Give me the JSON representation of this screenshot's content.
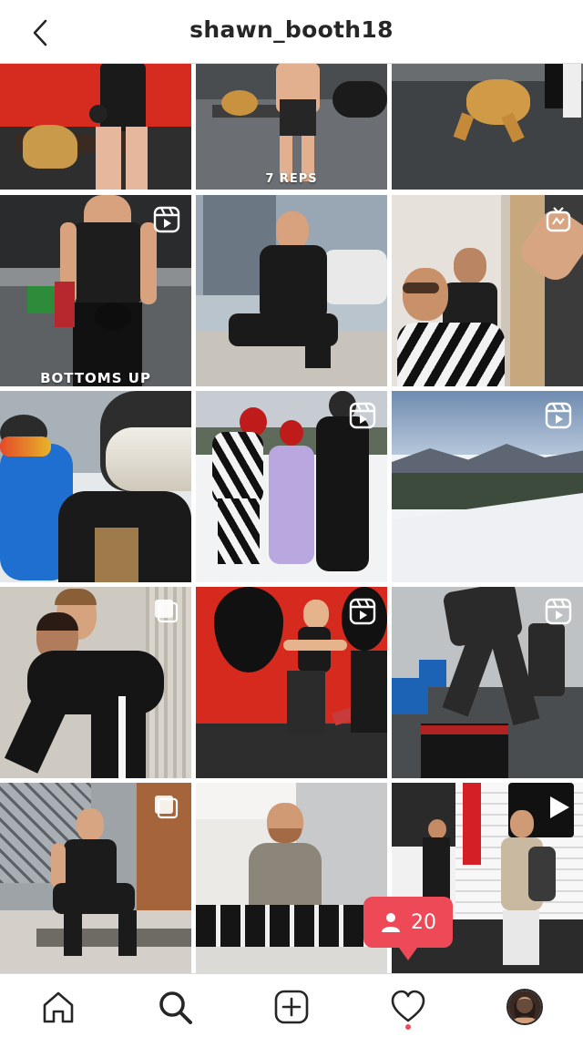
{
  "header": {
    "username": "shawn_booth18",
    "back_icon": "chevron-left-icon"
  },
  "grid": {
    "tiles": [
      {
        "caption": "",
        "overlay_icon": ""
      },
      {
        "caption": "7 REPS",
        "overlay_icon": ""
      },
      {
        "caption": "",
        "overlay_icon": ""
      },
      {
        "caption": "BOTTOMS UP",
        "overlay_icon": "reels-icon"
      },
      {
        "caption": "",
        "overlay_icon": ""
      },
      {
        "caption": "",
        "overlay_icon": "igtv-icon"
      },
      {
        "caption": "",
        "overlay_icon": "reels-icon"
      },
      {
        "caption": "",
        "overlay_icon": "reels-icon"
      },
      {
        "caption": "",
        "overlay_icon": "reels-icon"
      },
      {
        "caption": "",
        "overlay_icon": "carousel-icon"
      },
      {
        "caption": "",
        "overlay_icon": "reels-icon"
      },
      {
        "caption": "",
        "overlay_icon": "reels-icon"
      },
      {
        "caption": "",
        "overlay_icon": "carousel-icon"
      },
      {
        "caption": "",
        "overlay_icon": ""
      },
      {
        "caption": "",
        "overlay_icon": "video-icon"
      }
    ]
  },
  "activity_badge": {
    "count": "20",
    "icon": "person-icon",
    "color": "#ed4956"
  },
  "nav": {
    "items": [
      {
        "name": "home",
        "icon": "home-icon"
      },
      {
        "name": "search",
        "icon": "search-icon"
      },
      {
        "name": "new-post",
        "icon": "plus-square-icon"
      },
      {
        "name": "activity",
        "icon": "heart-icon"
      },
      {
        "name": "profile",
        "icon": "avatar"
      }
    ]
  },
  "colors": {
    "text": "#262626",
    "border": "#dbdbdb",
    "accent": "#ed4956"
  }
}
